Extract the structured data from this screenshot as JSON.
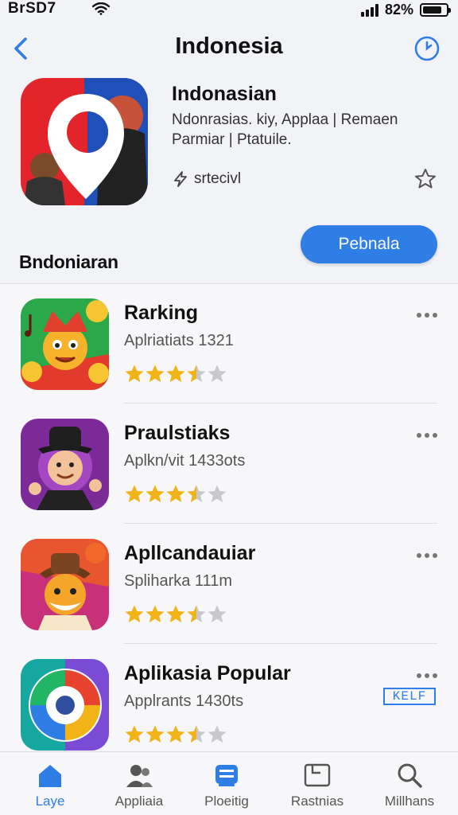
{
  "status_bar": {
    "carrier": "BrSD7",
    "battery": "82%",
    "battery_level": 0.82
  },
  "nav": {
    "title": "Indonesia"
  },
  "hero": {
    "title": "Indonasian",
    "description": "Ndonrasias. kiy, Applaa | Remaen Parmiar | Ptatuile.",
    "tag": "srtecivl",
    "button": "Pebnala"
  },
  "section": {
    "label": "Bndoniaran"
  },
  "apps": [
    {
      "title": "Rarking",
      "subtitle": "Aplriatiats 1321",
      "rating": 3.5
    },
    {
      "title": "Praulstiaks",
      "subtitle": "Aplkn/vit 1433ots",
      "rating": 3.5
    },
    {
      "title": "Apllcandauiar",
      "subtitle": "Spliharka 111m",
      "rating": 3.5
    },
    {
      "title": "Aplikasia Popular",
      "subtitle": "Applrants 1430ts",
      "rating": 3.5,
      "badge": "KELF"
    }
  ],
  "tabs": [
    {
      "label": "Laye",
      "icon": "home-icon",
      "active": true
    },
    {
      "label": "Appliaia",
      "icon": "people-icon",
      "active": false
    },
    {
      "label": "Ploeitig",
      "icon": "stack-icon",
      "active": false
    },
    {
      "label": "Rastnias",
      "icon": "folder-icon",
      "active": false
    },
    {
      "label": "Millhans",
      "icon": "search-icon",
      "active": false
    }
  ],
  "colors": {
    "accent": "#2f7ee6",
    "star": "#f2b317",
    "star_empty": "#c8c9cf"
  }
}
